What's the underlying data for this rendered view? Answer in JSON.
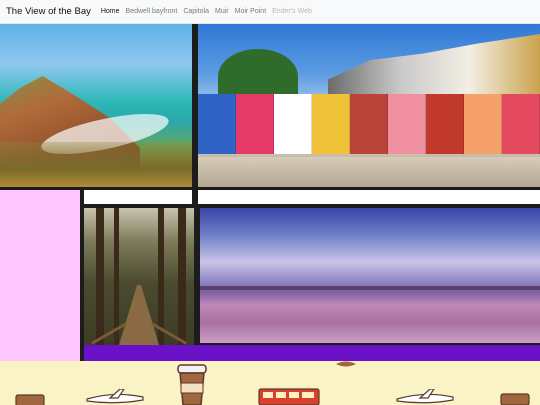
{
  "navbar": {
    "brand": "The View of the Bay",
    "links": [
      {
        "label": "Home",
        "state": "active"
      },
      {
        "label": "Bedwell bayfront",
        "state": "normal"
      },
      {
        "label": "Capitola",
        "state": "normal"
      },
      {
        "label": "Muir",
        "state": "normal"
      },
      {
        "label": "Moir Point",
        "state": "normal"
      },
      {
        "label": "Ender's Web",
        "state": "disabled"
      }
    ]
  },
  "colors": {
    "navbar_bg": "#f8f9fa",
    "grid_border": "#1c1c1c",
    "pink_block": "#ffc5ff",
    "purple_bar": "#6a12c8",
    "footer_bg": "#faf3c6"
  },
  "gallery": {
    "images": [
      {
        "subject": "coastal cliffs"
      },
      {
        "subject": "colorful houses"
      },
      {
        "subject": "forest path"
      },
      {
        "subject": "pink lake"
      }
    ]
  },
  "footer": {
    "icons": [
      "coffee-cup-icon",
      "airplane-icon",
      "bus-icon",
      "book-icon",
      "suitcase-icon",
      "leaf-icon"
    ]
  }
}
